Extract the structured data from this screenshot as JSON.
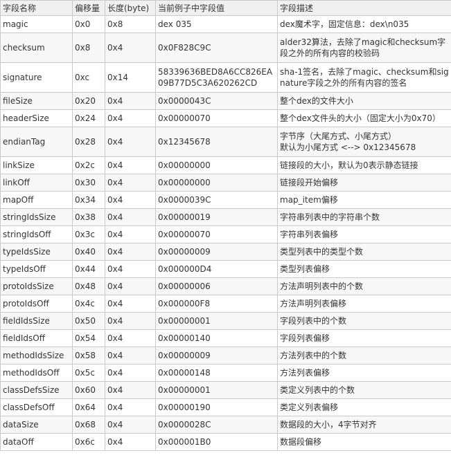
{
  "headers": [
    "字段名称",
    "偏移量",
    "长度(byte)",
    "当前例子中字段值",
    "字段描述"
  ],
  "rows": [
    {
      "name": "magic",
      "offset": "0x0",
      "length": "0x8",
      "value": "dex 035",
      "desc": "dex魔术字，固定信息：dex\\n035"
    },
    {
      "name": "checksum",
      "offset": "0x8",
      "length": "0x4",
      "value": "0x0F828C9C",
      "desc": "alder32算法，去除了magic和checksum字段之外的所有内容的校验码"
    },
    {
      "name": "signature",
      "offset": "0xc",
      "length": "0x14",
      "value": "58339636BED8A6CC826EA09B77D5C3A620262CD",
      "desc": "sha-1签名，去除了magic、checksum和signature字段之外的所有内容的签名"
    },
    {
      "name": "fileSize",
      "offset": "0x20",
      "length": "0x4",
      "value": "0x0000043C",
      "desc": "整个dex的文件大小"
    },
    {
      "name": "headerSize",
      "offset": "0x24",
      "length": "0x4",
      "value": "0x00000070",
      "desc": "整个dex文件头的大小（固定大小为0x70）"
    },
    {
      "name": "endianTag",
      "offset": "0x28",
      "length": "0x4",
      "value": "0x12345678",
      "desc": "字节序（大尾方式、小尾方式）",
      "desc2": "默认为小尾方式 <--> 0x12345678"
    },
    {
      "name": "linkSize",
      "offset": "0x2c",
      "length": "0x4",
      "value": "0x00000000",
      "desc": "链接段的大小，默认为0表示静态链接"
    },
    {
      "name": "linkOff",
      "offset": "0x30",
      "length": "0x4",
      "value": "0x00000000",
      "desc": "链接段开始偏移"
    },
    {
      "name": "mapOff",
      "offset": "0x34",
      "length": "0x4",
      "value": "0x0000039C",
      "desc": "map_item偏移"
    },
    {
      "name": "stringIdsSize",
      "offset": "0x38",
      "length": "0x4",
      "value": "0x00000019",
      "desc": "字符串列表中的字符串个数"
    },
    {
      "name": "stringIdsOff",
      "offset": "0x3c",
      "length": "0x4",
      "value": "0x00000070",
      "desc": "字符串列表偏移"
    },
    {
      "name": "typeIdsSize",
      "offset": "0x40",
      "length": "0x4",
      "value": "0x00000009",
      "desc": "类型列表中的类型个数"
    },
    {
      "name": "typeIdsOff",
      "offset": "0x44",
      "length": "0x4",
      "value": "0x000000D4",
      "desc": "类型列表偏移"
    },
    {
      "name": "protoIdsSize",
      "offset": "0x48",
      "length": "0x4",
      "value": "0x00000006",
      "desc": "方法声明列表中的个数"
    },
    {
      "name": "protoIdsOff",
      "offset": "0x4c",
      "length": "0x4",
      "value": "0x000000F8",
      "desc": "方法声明列表偏移"
    },
    {
      "name": "fieldIdsSize",
      "offset": "0x50",
      "length": "0x4",
      "value": "0x00000001",
      "desc": "字段列表中的个数"
    },
    {
      "name": "fieldIdsOff",
      "offset": "0x54",
      "length": "0x4",
      "value": "0x00000140",
      "desc": "字段列表偏移"
    },
    {
      "name": "methodIdsSize",
      "offset": "0x58",
      "length": "0x4",
      "value": "0x00000009",
      "desc": "方法列表中的个数"
    },
    {
      "name": "methodIdsOff",
      "offset": "0x5c",
      "length": "0x4",
      "value": "0x00000148",
      "desc": "方法列表偏移"
    },
    {
      "name": "classDefsSize",
      "offset": "0x60",
      "length": "0x4",
      "value": "0x00000001",
      "desc": "类定义列表中的个数"
    },
    {
      "name": "classDefsOff",
      "offset": "0x64",
      "length": "0x4",
      "value": "0x00000190",
      "desc": "类定义列表偏移"
    },
    {
      "name": "dataSize",
      "offset": "0x68",
      "length": "0x4",
      "value": "0x0000028C",
      "desc": "数据段的大小，4字节对齐"
    },
    {
      "name": "dataOff",
      "offset": "0x6c",
      "length": "0x4",
      "value": "0x000001B0",
      "desc": "数据段偏移"
    }
  ]
}
